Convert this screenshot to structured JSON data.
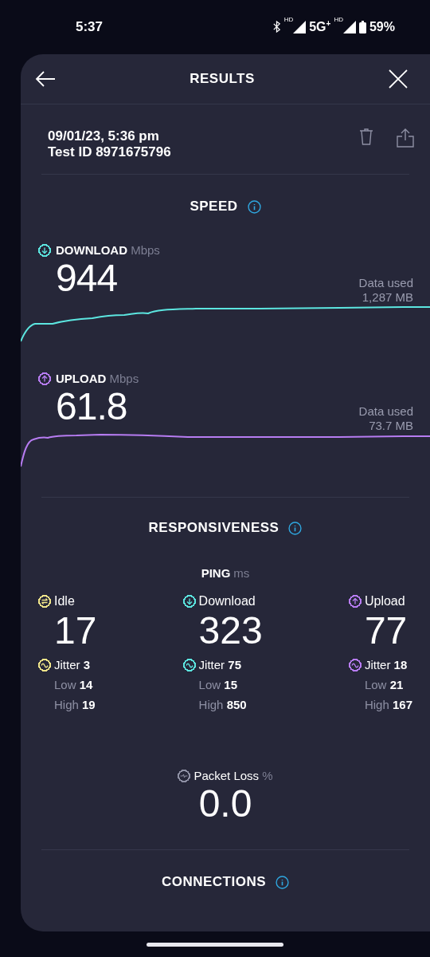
{
  "status_bar": {
    "time": "5:37",
    "hd_badges": [
      "HD",
      "HD"
    ],
    "network": "5G$^{+}$",
    "battery": "59%"
  },
  "header": {
    "title": "RESULTS"
  },
  "test": {
    "datetime": "09/01/23, 5:36 pm",
    "test_id": "Test ID 8971675796"
  },
  "speed": {
    "heading": "SPEED",
    "tests": [
      {
        "kind": "download",
        "label": "DOWNLOAD",
        "unit": "Mbps",
        "value": "944",
        "data_used_label": "Data used",
        "data_used": "1,287 MB",
        "color": "#5ce6e0"
      },
      {
        "kind": "upload",
        "label": "UPLOAD",
        "unit": "Mbps",
        "value": "61.8",
        "data_used_label": "Data used",
        "data_used": "73.7 MB",
        "color": "#b77cf2"
      }
    ]
  },
  "responsiveness": {
    "heading": "RESPONSIVENESS",
    "ping_label": "PING",
    "ping_unit": "ms",
    "columns": [
      {
        "kind": "idle",
        "label": "Idle",
        "value": "17",
        "jitter_label": "Jitter",
        "jitter": "3",
        "low_label": "Low",
        "low": "14",
        "high_label": "High",
        "high": "19",
        "color": "#efe48a"
      },
      {
        "kind": "download",
        "label": "Download",
        "value": "323",
        "jitter_label": "Jitter",
        "jitter": "75",
        "low_label": "Low",
        "low": "15",
        "high_label": "High",
        "high": "850",
        "color": "#5ce6e0"
      },
      {
        "kind": "upload",
        "label": "Upload",
        "value": "77",
        "jitter_label": "Jitter",
        "jitter": "18",
        "low_label": "Low",
        "low": "21",
        "high_label": "High",
        "high": "167",
        "color": "#b77cf2"
      }
    ],
    "packet_loss": {
      "label": "Packet Loss",
      "unit": "%",
      "value": "0.0"
    }
  },
  "connections": {
    "heading": "CONNECTIONS"
  }
}
